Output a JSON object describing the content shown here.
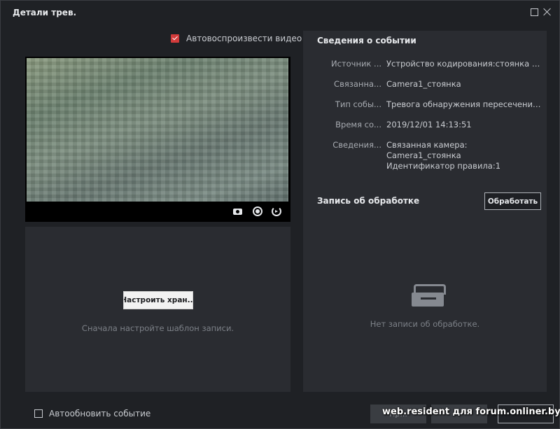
{
  "window": {
    "title": "Детали трев."
  },
  "video": {
    "autoplay_label": "Автовоспроизвести видео",
    "autoplay_checked": true,
    "controls": [
      "camera-icon",
      "record-icon",
      "replay-icon"
    ]
  },
  "storage": {
    "config_button": "Настроить хран...",
    "hint": "Сначала настройте шаблон записи."
  },
  "event_info": {
    "title": "Сведения о событии",
    "rows": [
      {
        "label": "Источник ...",
        "value": "Устройство кодирования:стоянка С..."
      },
      {
        "label": "Связанна...",
        "value": "Camera1_стоянка"
      },
      {
        "label": "Тип собы...",
        "value": "Тревога обнаружения пересечения ..."
      },
      {
        "label": "Время со...",
        "value": "2019/12/01 14:13:51"
      },
      {
        "label": "Сведения...",
        "value_line1": "Связанная камера: Camera1_стоянка",
        "value_line2": "Идентификатор правила:1"
      }
    ]
  },
  "processing": {
    "title": "Запись об обработке",
    "process_button": "Обработать",
    "empty_text": "Нет записи об обработке."
  },
  "footer": {
    "autorefresh_label": "Автообновить событие",
    "autorefresh_checked": false,
    "button1": "Пр...",
    "button2": "",
    "button3": ""
  },
  "watermark": "web.resident для forum.onliner.by",
  "colors": {
    "accent": "#d23b3b",
    "background": "#1f2125",
    "panel": "#2a2c31"
  }
}
